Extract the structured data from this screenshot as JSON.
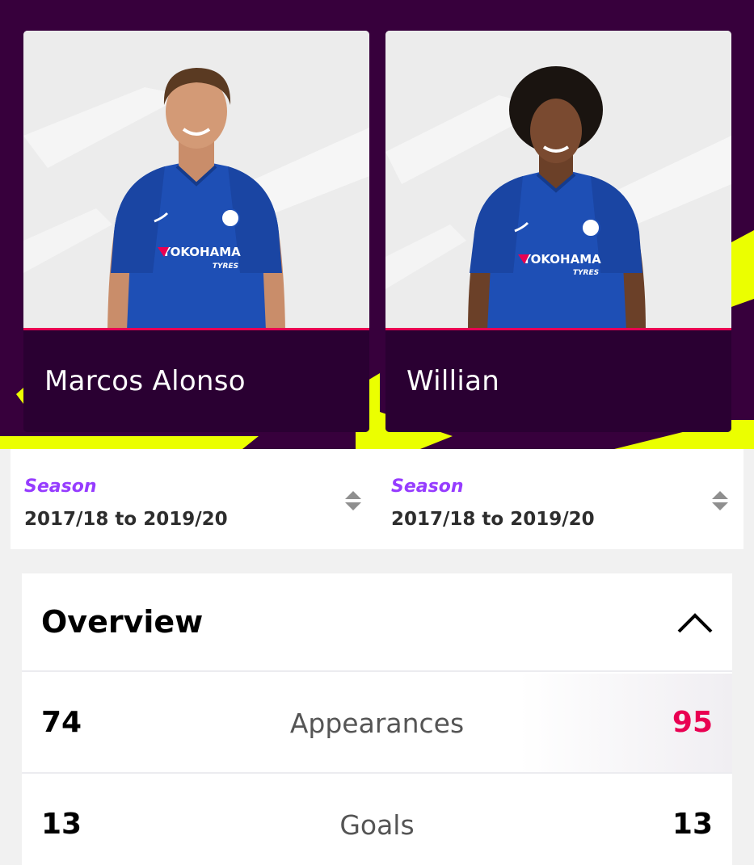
{
  "players": [
    {
      "name": "Marcos Alonso",
      "shirt_sponsor": "YOKOHAMA",
      "shirt_sponsor_sub": "TYRES"
    },
    {
      "name": "Willian",
      "shirt_sponsor": "YOKOHAMA",
      "shirt_sponsor_sub": "TYRES"
    }
  ],
  "season_selectors": [
    {
      "label": "Season",
      "value": "2017/18 to 2019/20"
    },
    {
      "label": "Season",
      "value": "2017/18 to 2019/20"
    }
  ],
  "overview": {
    "title": "Overview",
    "rows": [
      {
        "left": "74",
        "label": "Appearances",
        "right": "95",
        "right_highlight": true
      },
      {
        "left": "13",
        "label": "Goals",
        "right": "13",
        "right_highlight": false
      }
    ]
  },
  "colors": {
    "header_bg": "#37003c",
    "accent_yellow": "#ebff00",
    "season_label": "#963cff",
    "highlight": "#e90052"
  }
}
